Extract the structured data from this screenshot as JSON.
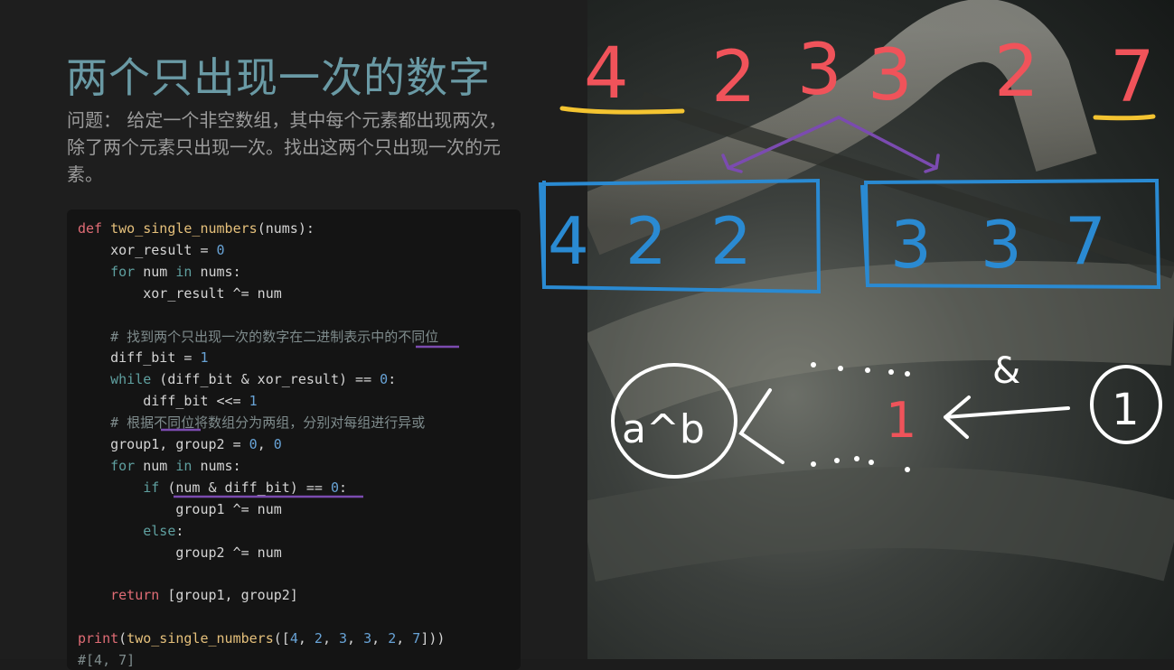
{
  "slide": {
    "title": "两个只出现一次的数字",
    "problem": "问题： 给定一个非空数组，其中每个元素都出现两次，除了两个元素只出现一次。找出这两个只出现一次的元素。"
  },
  "code": {
    "lines": [
      "def two_single_numbers(nums):",
      "    xor_result = 0",
      "    for num in nums:",
      "        xor_result ^= num",
      "",
      "    # 找到两个只出现一次的数字在二进制表示中的不同位",
      "    diff_bit = 1",
      "    while (diff_bit & xor_result) == 0:",
      "        diff_bit <<= 1",
      "    # 根据不同位将数组分为两组，分别对每组进行异或",
      "    group1, group2 = 0, 0",
      "    for num in nums:",
      "        if (num & diff_bit) == 0:",
      "            group1 ^= num",
      "        else:",
      "            group2 ^= num",
      "",
      "    return [group1, group2]",
      "",
      "print(two_single_numbers([4, 2, 3, 3, 2, 7]))",
      "#[4, 7]"
    ]
  },
  "annotations": {
    "top_numbers": [
      "4",
      "2",
      "3",
      "3",
      "2",
      "7"
    ],
    "group_left": [
      "4",
      "2",
      "2"
    ],
    "group_right": [
      "3",
      "3",
      "7"
    ],
    "xor_label": "a^b",
    "and_label": "&",
    "bit_one": "1",
    "colors": {
      "red": "#f0535a",
      "blue": "#2a8ad2",
      "purple": "#7b4bb0",
      "yellow": "#f4c431",
      "white": "#ffffff"
    }
  }
}
